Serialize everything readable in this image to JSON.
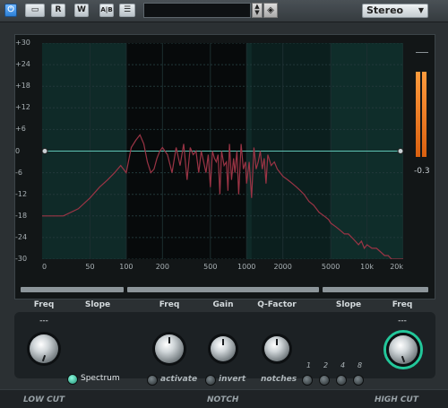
{
  "toolbar": {
    "read_label": "R",
    "write_label": "W",
    "ab_label": "A|B",
    "preset_name": "",
    "channel_mode": "Stereo"
  },
  "display": {
    "y_axis_labels": [
      "+30",
      "+24",
      "+18",
      "+12",
      "+6",
      "0",
      "-6",
      "-12",
      "-18",
      "-24",
      "-30"
    ],
    "x_axis_labels": [
      "0",
      "50",
      "100",
      "200",
      "500",
      "1000",
      "2000",
      "5000",
      "10k",
      "20k"
    ],
    "meter_value": "-0.3",
    "spectrum_color": "#9b3445",
    "zero_line_color": "#5fc3b4"
  },
  "controls": {
    "low_cut": {
      "freq_label": "Freq",
      "slope_label": "Slope",
      "freq_value": "---"
    },
    "notch": {
      "freq_label": "Freq",
      "gain_label": "Gain",
      "q_label": "Q-Factor",
      "activate_label": "activate",
      "invert_label": "invert",
      "notches_label": "notches",
      "notch_counts": [
        "1",
        "2",
        "4",
        "8"
      ]
    },
    "high_cut": {
      "slope_label": "Slope",
      "freq_label": "Freq",
      "freq_value": "---"
    },
    "spectrum_label": "Spectrum"
  },
  "footer": {
    "low_cut_label": "LOW CUT",
    "notch_label": "NOTCH",
    "high_cut_label": "HIGH CUT"
  },
  "chart_data": {
    "type": "line",
    "xlabel": "",
    "ylabel": "",
    "x_scale": "log",
    "xlim": [
      20,
      20000
    ],
    "ylim": [
      -30,
      30
    ],
    "series": [
      {
        "x": [
          20,
          30,
          40,
          50,
          60,
          70,
          80,
          90,
          100,
          110,
          120,
          130,
          140,
          150,
          160,
          170,
          180,
          190,
          200,
          220,
          240,
          260,
          280,
          300,
          320,
          340,
          360,
          380,
          400,
          420,
          440,
          460,
          480,
          500,
          520,
          540,
          560,
          580,
          600,
          620,
          650,
          680,
          700,
          720,
          750,
          780,
          800,
          830,
          860,
          900,
          940,
          980,
          1000,
          1050,
          1100,
          1150,
          1200,
          1250,
          1300,
          1350,
          1400,
          1450,
          1500,
          1600,
          1700,
          1800,
          1900,
          2000,
          2200,
          2400,
          2600,
          2800,
          3000,
          3300,
          3600,
          4000,
          4400,
          4800,
          5000,
          5500,
          6000,
          6500,
          7000,
          7500,
          8000,
          8500,
          9000,
          9500,
          10000,
          11000,
          12000,
          13000,
          14000,
          15000,
          16000,
          17000,
          18000,
          19000,
          20000
        ],
        "y": [
          -18,
          -18,
          -16,
          -13,
          -10,
          -8,
          -6,
          -4,
          -6,
          1,
          3,
          4.5,
          2,
          -3,
          -6,
          -5,
          -2,
          0,
          1,
          -1,
          -6,
          1,
          -4,
          2,
          -8,
          1,
          -1,
          0,
          -6,
          0,
          -3,
          -6,
          -1,
          -10,
          0,
          -2,
          -3,
          -1,
          -12,
          0,
          -4,
          -3,
          -11,
          2,
          -8,
          -2,
          -6,
          0,
          -12,
          2,
          -5,
          -3,
          -9,
          -3,
          -13,
          1,
          -5,
          -3,
          0,
          -5,
          -2,
          -9,
          -1,
          -4,
          -3,
          -5,
          -6,
          -7,
          -8,
          -9,
          -10,
          -11,
          -12,
          -14,
          -15,
          -17,
          -18,
          -19,
          -20,
          -21,
          -22,
          -23,
          -23,
          -24,
          -25,
          -26,
          -25,
          -27,
          -26,
          -27,
          -27,
          -28,
          -29,
          -29,
          -30,
          -30,
          -30,
          -30,
          -30
        ]
      }
    ]
  }
}
